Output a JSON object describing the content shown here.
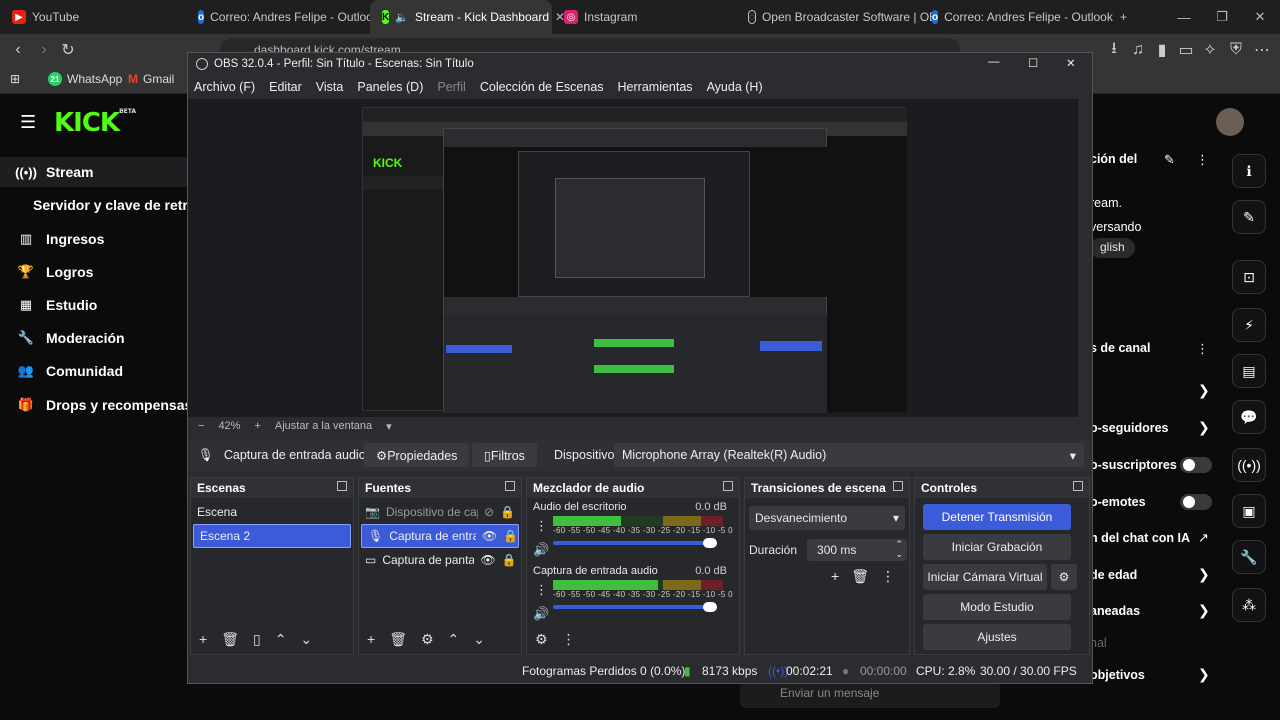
{
  "browser": {
    "tabs": [
      {
        "label": "YouTube",
        "fav": "youtube-icon"
      },
      {
        "label": "Correo: Andres Felipe - Outlook",
        "fav": "outlook-icon"
      },
      {
        "label": "Stream - Kick Dashboard",
        "fav": "kick-icon"
      },
      {
        "label": "Instagram",
        "fav": "instagram-icon"
      },
      {
        "label": "Open Broadcaster Software | OB",
        "fav": "obs-icon"
      },
      {
        "label": "Correo: Andres Felipe - Outlook",
        "fav": "outlook-icon"
      }
    ],
    "address": "dashboard.kick.com/stream",
    "bookmarks": [
      {
        "label": "WhatsApp"
      },
      {
        "label": "Gmail"
      }
    ]
  },
  "kick": {
    "logo": "KICK",
    "logo_beta": "BETA",
    "nav": [
      {
        "label": "Stream",
        "icon": "broadcast-icon"
      },
      {
        "label": "Servidor y clave de retra",
        "icon": ""
      },
      {
        "label": "Ingresos",
        "icon": "bank-icon"
      },
      {
        "label": "Logros",
        "icon": "trophy-icon"
      },
      {
        "label": "Estudio",
        "icon": "chart-icon"
      },
      {
        "label": "Moderación",
        "icon": "wrench-icon"
      },
      {
        "label": "Comunidad",
        "icon": "people-icon"
      },
      {
        "label": "Drops y recompensas",
        "icon": "gift-icon"
      }
    ],
    "right": {
      "t1": "ción del",
      "t2": "ream.",
      "t3": "versando",
      "t4": "glish",
      "t5": "s de canal",
      "t6": "o-seguidores",
      "t7": "o-suscriptores",
      "t8": "o-emotes",
      "t9": "n del chat con IA",
      "t10": "de edad",
      "t11": "aneadas",
      "t12": "nal",
      "t13": "objetivos",
      "chat_placeholder": "Enviar un mensaje"
    }
  },
  "obs": {
    "title": "OBS 32.0.4 - Perfil: Sin Título - Escenas: Sin Título",
    "menu": [
      "Archivo (F)",
      "Editar",
      "Vista",
      "Paneles (D)",
      "Perfil",
      "Colección de Escenas",
      "Herramientas",
      "Ayuda (H)"
    ],
    "zoom": "42%",
    "fit": "Ajustar a la ventana",
    "source_selected": "Captura de entrada audio",
    "properties": "Propiedades",
    "filters": "Filtros",
    "device_label": "Dispositivo",
    "device_value": "Microphone Array (Realtek(R) Audio)",
    "scenes_title": "Escenas",
    "scenes": [
      "Escena",
      "Escena 2"
    ],
    "sources_title": "Fuentes",
    "sources": [
      "Dispositivo de cap",
      "Captura de entrac",
      "Captura de panta"
    ],
    "mixer_title": "Mezclador de audio",
    "mixer": [
      {
        "name": "Audio del escritorio",
        "db": "0.0 dB",
        "level": 0.12
      },
      {
        "name": "Captura de entrada audio",
        "db": "0.0 dB",
        "level": 0.45
      }
    ],
    "meter_ticks": "-60 -55 -50 -45 -40 -35 -30 -25 -20 -15 -10 -5 0",
    "transitions_title": "Transiciones de escena",
    "transition": "Desvanecimiento",
    "duration_label": "Duración",
    "duration": "300 ms",
    "controls_title": "Controles",
    "controls": [
      "Detener Transmisión",
      "Iniciar Grabación",
      "Iniciar Cámara Virtual",
      "Modo Estudio",
      "Ajustes"
    ],
    "status": {
      "frames": "Fotogramas Perdidos 0 (0.0%)",
      "bitrate": "8173 kbps",
      "stream_time": "00:02:21",
      "rec_time": "00:00:00",
      "cpu": "CPU: 2.8%",
      "fps": "30.00 / 30.00 FPS"
    }
  }
}
